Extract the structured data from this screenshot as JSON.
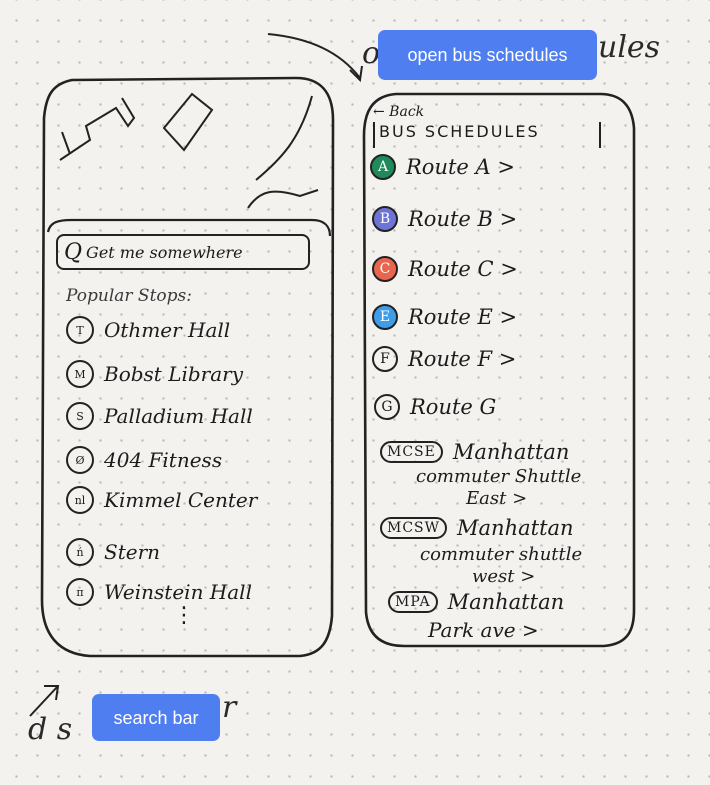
{
  "annotations": {
    "open_bus_schedules": "open bus schedules",
    "search_bar": "search bar",
    "top_fragment_left": "o",
    "top_fragment_right": "ules",
    "bottom_fragment_left": "d s",
    "bottom_fragment_right": "r"
  },
  "left_screen": {
    "search_placeholder": "Get me somewhere",
    "search_icon": "Q",
    "popular_label": "Popular Stops:",
    "stops": [
      {
        "name": "Othmer Hall",
        "icon": "T"
      },
      {
        "name": "Bobst Library",
        "icon": "M"
      },
      {
        "name": "Palladium Hall",
        "icon": "S"
      },
      {
        "name": "404 Fitness",
        "icon": "Ø"
      },
      {
        "name": "Kimmel Center",
        "icon": "nl"
      },
      {
        "name": "Stern",
        "icon": "ń"
      },
      {
        "name": "Weinstein Hall",
        "icon": "π"
      }
    ],
    "more": "⋮"
  },
  "right_screen": {
    "back_label": "← Back",
    "title": "BUS SCHEDULES",
    "routes": [
      {
        "badge": "A",
        "label": "Route A >",
        "color": "#1f8a5a"
      },
      {
        "badge": "B",
        "label": "Route B >",
        "color": "#6e73d6"
      },
      {
        "badge": "C",
        "label": "Route C >",
        "color": "#e8664e"
      },
      {
        "badge": "E",
        "label": "Route E >",
        "color": "#3e9de8"
      },
      {
        "badge": "F",
        "label": "Route F >",
        "color": ""
      },
      {
        "badge": "G",
        "label": "Route G",
        "color": ""
      }
    ],
    "shuttles": [
      {
        "badge": "MCSE",
        "line1": "Manhattan",
        "line2": "commuter Shuttle",
        "line3": "East >"
      },
      {
        "badge": "MCSW",
        "line1": "Manhattan",
        "line2": "commuter shuttle",
        "line3": "west >"
      },
      {
        "badge": "MPA",
        "line1": "Manhattan",
        "line2": "Park ave >",
        "line3": ""
      }
    ]
  }
}
